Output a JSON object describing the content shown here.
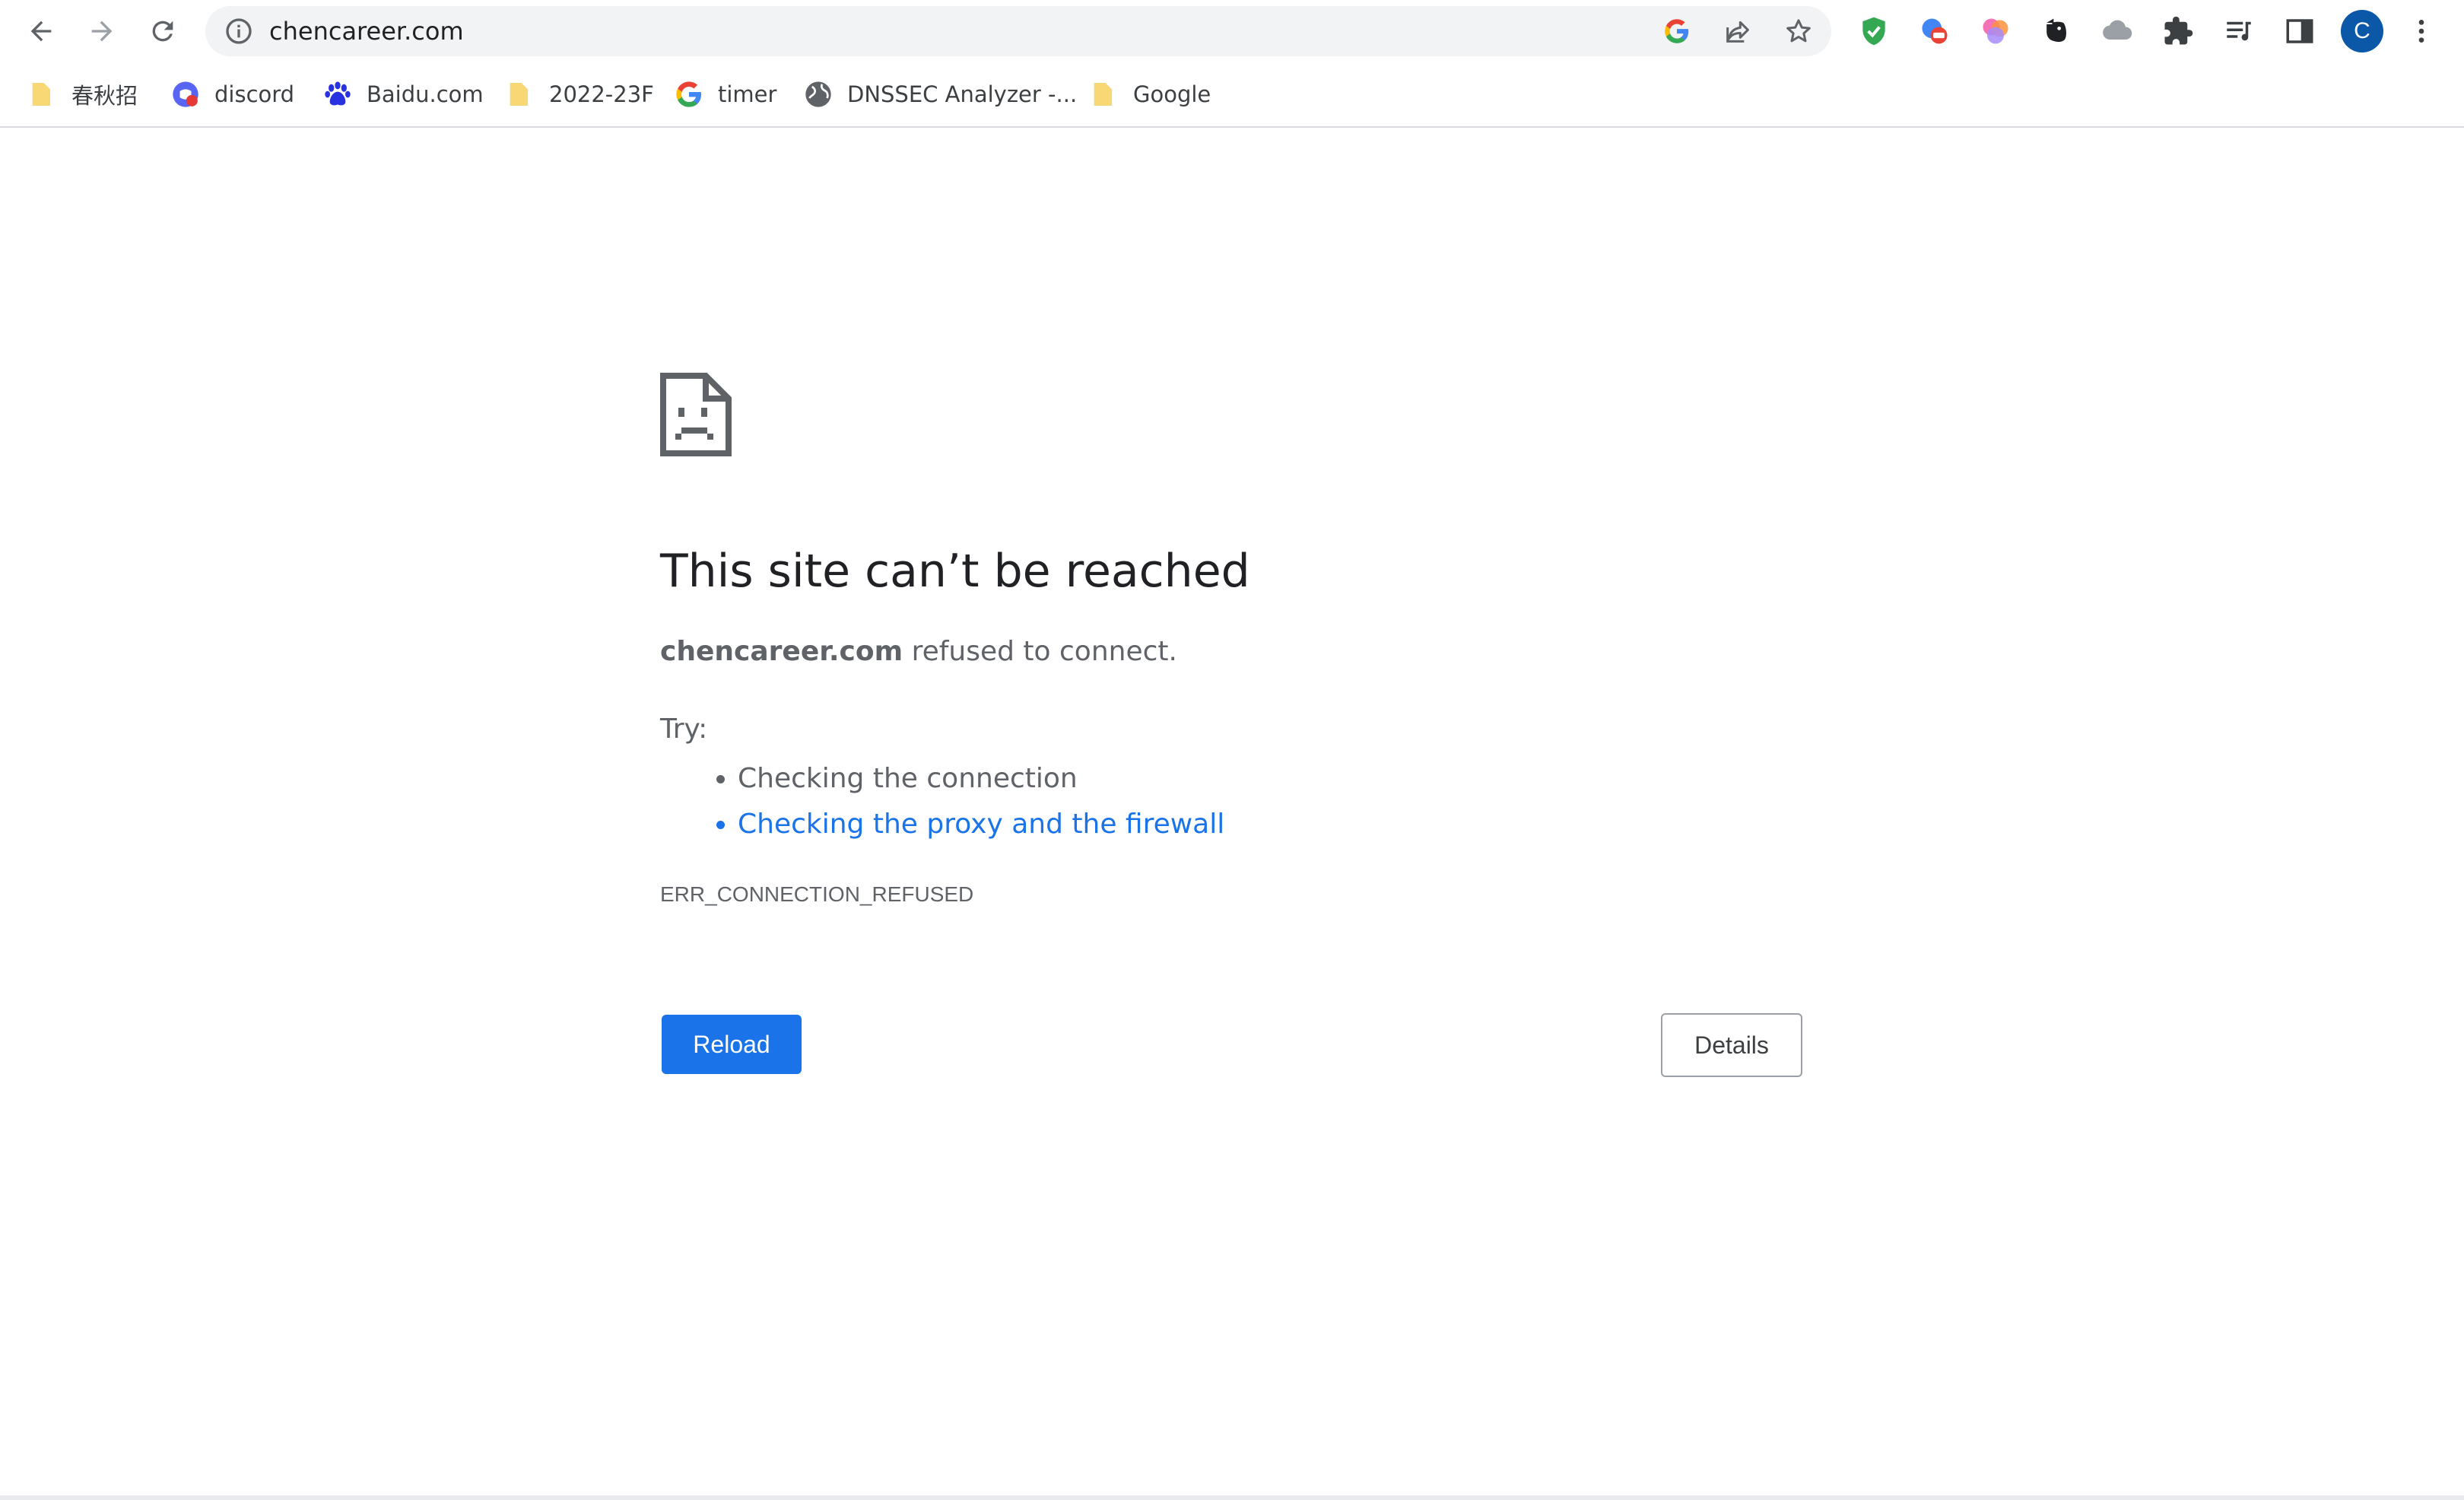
{
  "toolbar": {
    "url": "chencareer.com",
    "avatar_initial": "C"
  },
  "icons": {
    "back": "back-arrow-icon",
    "forward": "forward-arrow-icon",
    "reload": "reload-icon",
    "site_info": "info-icon",
    "google": "google-icon",
    "share": "share-icon",
    "bookmark_star": "star-icon",
    "extensions": [
      "shield-check-icon",
      "translate-icon",
      "colorful-circles-icon",
      "elephant-icon",
      "cloud-icon",
      "puzzle-icon",
      "media-queue-icon",
      "side-panel-icon"
    ],
    "menu": "three-dot-menu-icon"
  },
  "bookmarks": [
    {
      "label": "春秋招",
      "icon": "folder-icon"
    },
    {
      "label": "discord",
      "icon": "discord-icon"
    },
    {
      "label": "Baidu.com",
      "icon": "baidu-paw-icon"
    },
    {
      "label": "2022-23F",
      "icon": "folder-icon"
    },
    {
      "label": "timer",
      "icon": "google-icon"
    },
    {
      "label": "DNSSEC Analyzer -...",
      "icon": "globe-icon"
    },
    {
      "label": "Google",
      "icon": "folder-icon"
    }
  ],
  "error": {
    "title": "This site can’t be reached",
    "host": "chencareer.com",
    "message_suffix": " refused to connect.",
    "try_label": "Try:",
    "suggestions": [
      "Checking the connection",
      "Checking the proxy and the firewall"
    ],
    "code": "ERR_CONNECTION_REFUSED",
    "reload_label": "Reload",
    "details_label": "Details"
  },
  "colors": {
    "accent": "#1a73e8",
    "text_primary": "#202124",
    "text_secondary": "#5f6368",
    "folder": "#f8d775",
    "avatar": "#0b57a8"
  }
}
